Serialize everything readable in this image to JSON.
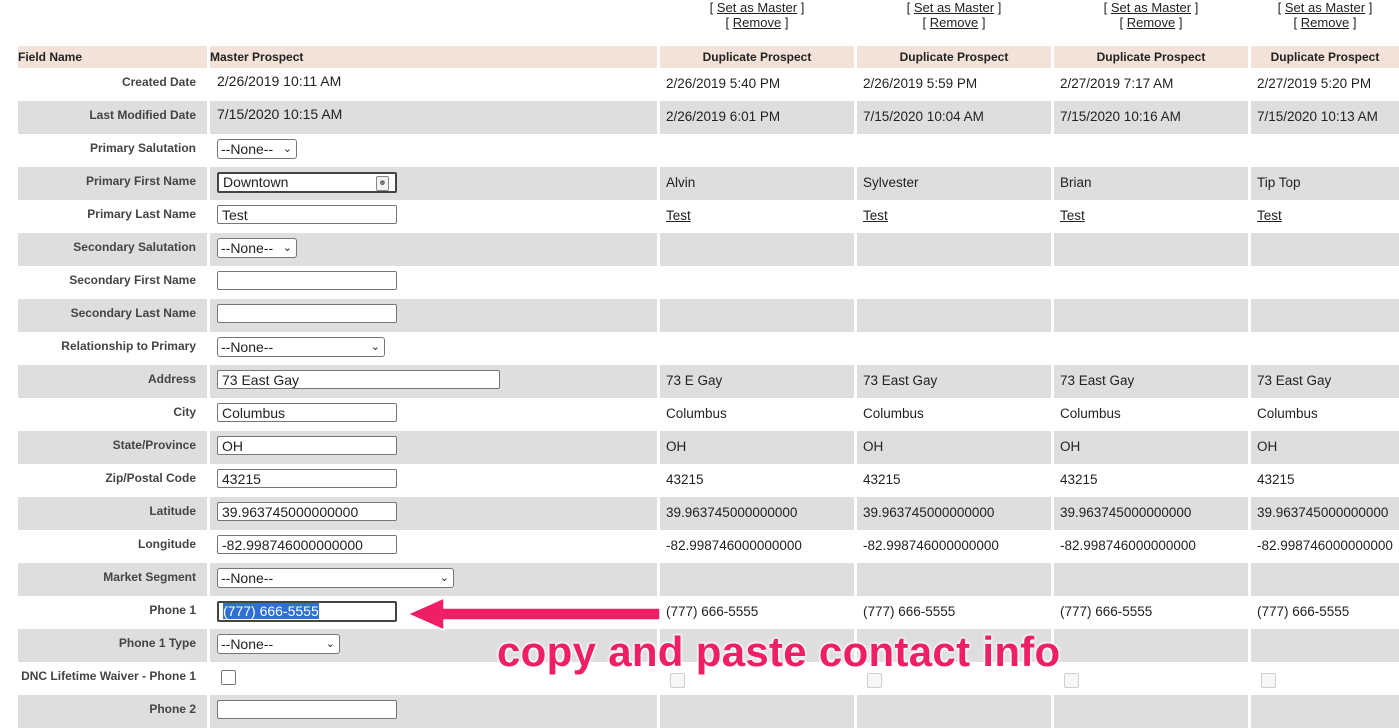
{
  "columns": {
    "field_name": "Field Name",
    "master": "Master Prospect",
    "duplicate": "Duplicate Prospect"
  },
  "actions": {
    "set_master": "[ Set as Master ]",
    "remove": "[ Remove ]"
  },
  "set_master_label": "Set as Master",
  "remove_label": "Remove",
  "rows": {
    "created": {
      "label": "Created Date",
      "master": "2/26/2019 10:11 AM",
      "dups": [
        "2/26/2019 5:40 PM",
        "2/26/2019 5:59 PM",
        "2/27/2019 7:17 AM",
        "2/27/2019 5:20 PM"
      ]
    },
    "modified": {
      "label": "Last Modified Date",
      "master": "7/15/2020 10:15 AM",
      "dups": [
        "2/26/2019 6:01 PM",
        "7/15/2020 10:04 AM",
        "7/15/2020 10:16 AM",
        "7/15/2020 10:13 AM"
      ]
    },
    "salutation": {
      "label": "Primary Salutation",
      "master": "--None--"
    },
    "first": {
      "label": "Primary First Name",
      "master": "Downtown",
      "dups": [
        "Alvin",
        "Sylvester",
        "Brian",
        "Tip Top"
      ]
    },
    "last": {
      "label": "Primary Last Name",
      "master": "Test",
      "dups": [
        "Test",
        "Test",
        "Test",
        "Test"
      ]
    },
    "sec_salutation": {
      "label": "Secondary Salutation",
      "master": "--None--"
    },
    "sec_first": {
      "label": "Secondary First Name",
      "master": ""
    },
    "sec_last": {
      "label": "Secondary Last Name",
      "master": ""
    },
    "relationship": {
      "label": "Relationship to Primary",
      "master": "--None--"
    },
    "address": {
      "label": "Address",
      "master": "73 East Gay",
      "dups": [
        "73 E Gay",
        "73 East Gay",
        "73 East Gay",
        "73 East Gay"
      ]
    },
    "city": {
      "label": "City",
      "master": "Columbus",
      "dups": [
        "Columbus",
        "Columbus",
        "Columbus",
        "Columbus"
      ]
    },
    "state": {
      "label": "State/Province",
      "master": "OH",
      "dups": [
        "OH",
        "OH",
        "OH",
        "OH"
      ]
    },
    "zip": {
      "label": "Zip/Postal Code",
      "master": "43215",
      "dups": [
        "43215",
        "43215",
        "43215",
        "43215"
      ]
    },
    "lat": {
      "label": "Latitude",
      "master": "39.963745000000000",
      "dups": [
        "39.963745000000000",
        "39.963745000000000",
        "39.963745000000000",
        "39.963745000000000"
      ]
    },
    "lon": {
      "label": "Longitude",
      "master": "-82.998746000000000",
      "dups": [
        "-82.998746000000000",
        "-82.998746000000000",
        "-82.998746000000000",
        "-82.998746000000000"
      ]
    },
    "segment": {
      "label": "Market Segment",
      "master": "--None--"
    },
    "phone1": {
      "label": "Phone 1",
      "master": "(777) 666-5555",
      "dups": [
        "(777) 666-5555",
        "(777) 666-5555",
        "(777) 666-5555",
        "(777) 666-5555"
      ]
    },
    "phone1_type": {
      "label": "Phone 1 Type",
      "master": "--None--"
    },
    "dnc1": {
      "label": "DNC Lifetime Waiver - Phone 1"
    },
    "phone2": {
      "label": "Phone 2",
      "master": ""
    }
  },
  "annotation": "copy and paste contact info",
  "colors": {
    "header_bg": "#f3e2d7",
    "alt_row": "#dedede",
    "annotation": "#ee1f63",
    "selection": "#2f6fd6"
  },
  "icons": {
    "contact_card": "contact-card-icon",
    "dropdown": "chevron-down-icon",
    "arrow": "annotation-arrow-icon"
  }
}
